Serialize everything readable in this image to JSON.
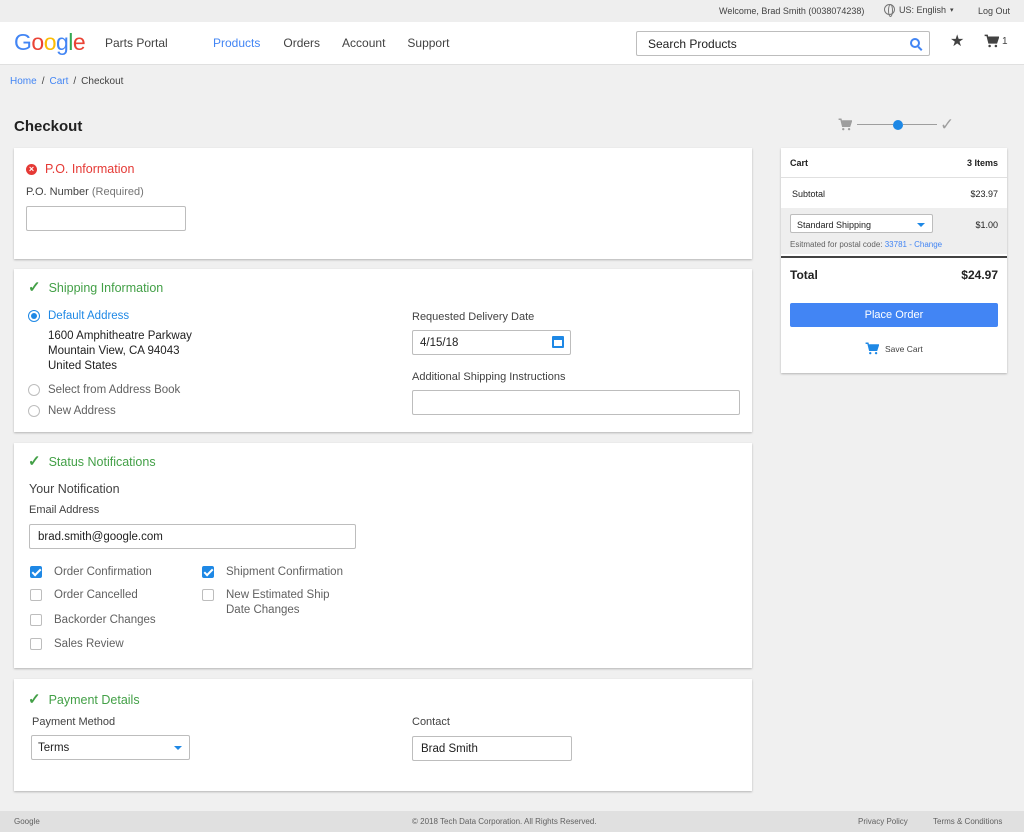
{
  "util_bar": {
    "welcome": "Welcome, Brad Smith (0038074238)",
    "language": "US: English",
    "logout": "Log Out"
  },
  "header": {
    "logo_letters": [
      "G",
      "o",
      "o",
      "g",
      "l",
      "e"
    ],
    "portal_name": "Parts Portal",
    "nav": [
      {
        "label": "Products",
        "active": true
      },
      {
        "label": "Orders",
        "active": false
      },
      {
        "label": "Account",
        "active": false
      },
      {
        "label": "Support",
        "active": false
      }
    ],
    "search_placeholder": "Search Products",
    "cart_count": "1"
  },
  "breadcrumb": {
    "items": [
      "Home",
      "Cart",
      "Checkout"
    ],
    "separator": "/"
  },
  "page_title": "Checkout",
  "stepper": {
    "steps": [
      "cart-icon",
      "current-step-dot",
      "check-icon"
    ],
    "current_index": 1
  },
  "po_section": {
    "title": "P.O. Information",
    "status": "error",
    "po_label": "P.O. Number",
    "po_required": "(Required)",
    "po_value": ""
  },
  "shipping_section": {
    "title": "Shipping Information",
    "status": "ok",
    "options": [
      {
        "label": "Default Address",
        "selected": true
      },
      {
        "label": "Select from Address Book",
        "selected": false
      },
      {
        "label": "New Address",
        "selected": false
      }
    ],
    "address_lines": [
      "1600 Amphitheatre Parkway",
      "Mountain View, CA 94043",
      "United States"
    ],
    "delivery_date_label": "Requested Delivery Date",
    "delivery_date_value": "4/15/18",
    "instructions_label": "Additional Shipping Instructions",
    "instructions_value": ""
  },
  "notifications_section": {
    "title": "Status Notifications",
    "status": "ok",
    "subtitle": "Your Notification",
    "email_label": "Email Address",
    "email_value": "brad.smith@google.com",
    "checkboxes_left": [
      {
        "label": "Order Confirmation",
        "checked": true
      },
      {
        "label": "Order Cancelled",
        "checked": false
      },
      {
        "label": "Backorder Changes",
        "checked": false
      },
      {
        "label": "Sales Review",
        "checked": false
      }
    ],
    "checkboxes_right": [
      {
        "label": "Shipment Confirmation",
        "checked": true
      },
      {
        "label": "New Estimated Ship Date Changes",
        "checked": false
      }
    ]
  },
  "payment_section": {
    "title": "Payment Details",
    "status": "ok",
    "method_label": "Payment Method",
    "method_value": "Terms",
    "contact_label": "Contact",
    "contact_value": "Brad Smith"
  },
  "summary": {
    "cart_label": "Cart",
    "items_count": "3 Items",
    "subtotal_label": "Subtotal",
    "subtotal_value": "$23.97",
    "shipping_method": "Standard Shipping",
    "shipping_value": "$1.00",
    "estimated_label": "Esitmated for postal code:",
    "postal_code": "33781",
    "change_link": "- Change",
    "total_label": "Total",
    "total_value": "$24.97",
    "place_order": "Place Order",
    "save_cart": "Save Cart"
  },
  "footer": {
    "brand": "Google",
    "copyright": "© 2018 Tech Data Corporation. All Rights Reserved.",
    "privacy": "Privacy Policy",
    "terms": "Terms & Conditions"
  },
  "colors": {
    "accent": "#4285f4",
    "error": "#e53935",
    "success": "#43a047"
  }
}
